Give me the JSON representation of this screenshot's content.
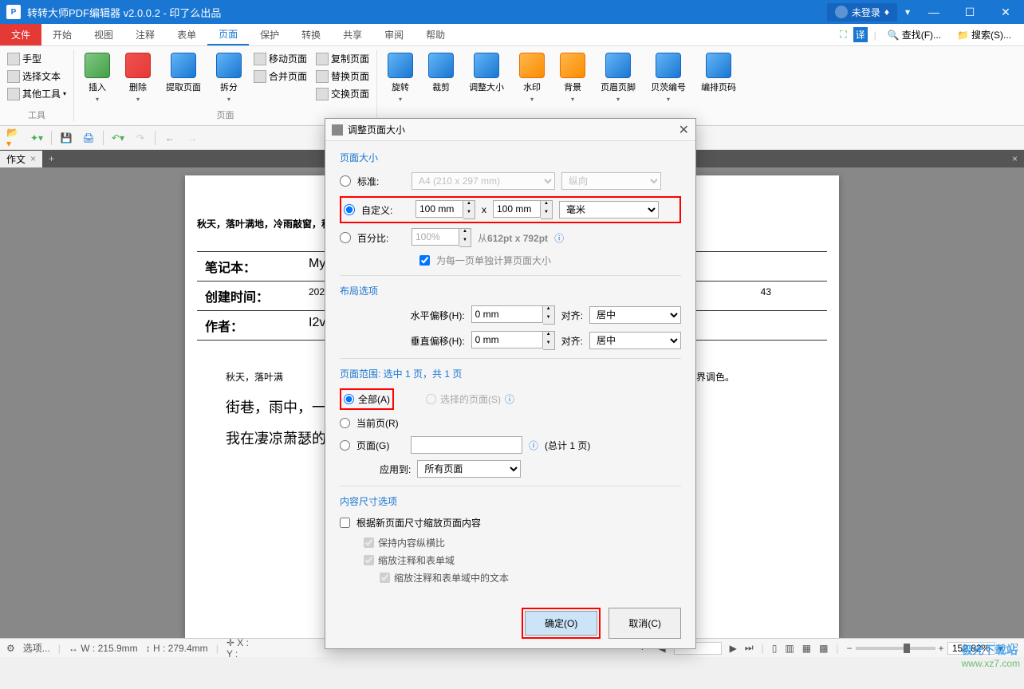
{
  "titlebar": {
    "app_name": "转转大师PDF编辑器 v2.0.0.2 - 印了么出品",
    "login_text": "未登录"
  },
  "menu": {
    "file": "文件",
    "start": "开始",
    "view": "视图",
    "annotate": "注释",
    "form": "表单",
    "page": "页面",
    "protect": "保护",
    "convert": "转换",
    "share": "共享",
    "review": "审阅",
    "help": "帮助",
    "find": "查找(F)...",
    "search": "搜索(S)..."
  },
  "ribbon": {
    "tools_group": "工具",
    "hand_tool": "手型",
    "select_text": "选择文本",
    "other_tools": "其他工具",
    "insert": "插入",
    "delete": "删除",
    "extract_pages": "提取页面",
    "split": "拆分",
    "move_page": "移动页面",
    "merge_page": "合并页面",
    "copy_page": "复制页面",
    "replace_page": "替换页面",
    "swap_page": "交换页面",
    "page_group": "页面",
    "rotate": "旋转",
    "crop": "裁剪",
    "resize": "调整大小",
    "watermark": "水印",
    "background": "背景",
    "header_footer": "页眉页脚",
    "bates": "贝茨编号",
    "page_num": "编排页码"
  },
  "tab": {
    "name": "作文"
  },
  "document": {
    "heading": "秋天，落叶满地，冷雨敲窗，秋风瑟瑟，一股悲凉给这个喧嚣的世界调色。",
    "notebook_label": "笔记本：",
    "notebook_value": "My Note",
    "created_label": "创建时间：",
    "created_value": "2023/2/2",
    "created_suffix": "43",
    "author_label": "作者：",
    "author_value": "I2v9i1ir",
    "para1a": "秋天，落叶满",
    "para1b": "悲凉给这个喧嚣的世界调色。",
    "para2": "街巷，雨中，一个人。",
    "para3": "我在凄凉萧瑟的细雨中慢慢行走，昏黄的街灯无力地洒下冰冷的光线，印"
  },
  "dialog": {
    "title": "调整页面大小",
    "page_size_section": "页面大小",
    "standard": "标准:",
    "standard_value": "A4 (210 x 297 mm)",
    "orientation": "纵向",
    "custom": "自定义:",
    "custom_w": "100 mm",
    "custom_h": "100 mm",
    "unit": "毫米",
    "x_label": "x",
    "percent": "百分比:",
    "percent_value": "100%",
    "from_label": "从",
    "pt_info": "612pt x 792pt",
    "calc_each": "为每一页单独计算页面大小",
    "layout_section": "布局选项",
    "h_offset": "水平偏移(H):",
    "h_offset_val": "0 mm",
    "v_offset": "垂直偏移(H):",
    "v_offset_val": "0 mm",
    "align": "对齐:",
    "align_val": "居中",
    "range_section": "页面范围: 选中 1 页，共 1 页",
    "all_pages": "全部(A)",
    "selected_pages": "选择的页面(S)",
    "current_page": "当前页(R)",
    "pages": "页面(G)",
    "total_pages": "(总计 1 页)",
    "apply_to": "应用到:",
    "apply_to_val": "所有页面",
    "content_section": "内容尺寸选项",
    "scale_content": "根据新页面尺寸缩放页面内容",
    "keep_ratio": "保持内容纵横比",
    "scale_annot": "缩放注释和表单域",
    "scale_annot_text": "缩放注释和表单域中的文本",
    "ok": "确定(O)",
    "cancel": "取消(C)"
  },
  "statusbar": {
    "options": "选项...",
    "w_label": "W :",
    "w_val": "215.9mm",
    "h_label": "H :",
    "h_val": "279.4mm",
    "x_label": "X :",
    "y_label": "Y :",
    "zoom": "152.82%"
  },
  "watermark": {
    "line1": "极光下载站",
    "line2": "www.xz7.com"
  }
}
